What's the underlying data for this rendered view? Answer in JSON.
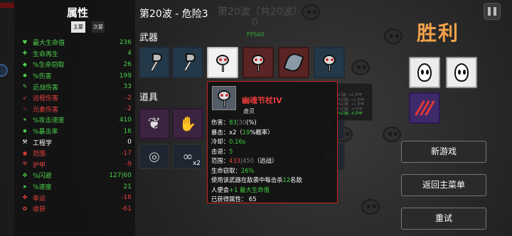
{
  "stats_panel": {
    "title": "属性",
    "tab_main": "主要",
    "tab_secondary": "次要",
    "rows": [
      {
        "label": "最大生命值",
        "value": "236",
        "color": "#4ccf4c",
        "icon": "heart-icon"
      },
      {
        "label": "生命再生",
        "value": "4",
        "color": "#4ccf4c",
        "icon": "plus-heart-icon"
      },
      {
        "label": "%生命窃取",
        "value": "26",
        "color": "#4ccf4c",
        "icon": "fang-icon"
      },
      {
        "label": "%伤害",
        "value": "199",
        "color": "#4ccf4c",
        "icon": "damage-icon"
      },
      {
        "label": "近战伤害",
        "value": "33",
        "color": "#4ccf4c",
        "icon": "sword-icon"
      },
      {
        "label": "远程伤害",
        "value": "-2",
        "color": "#e84040",
        "icon": "bow-icon"
      },
      {
        "label": "元素伤害",
        "value": "-2",
        "color": "#e84040",
        "icon": "flame-icon"
      },
      {
        "label": "%攻击速度",
        "value": "410",
        "color": "#4ccf4c",
        "icon": "speed-icon"
      },
      {
        "label": "%暴击率",
        "value": "16",
        "color": "#4ccf4c",
        "icon": "crit-icon"
      },
      {
        "label": "工程学",
        "value": "0",
        "color": "#ffffff",
        "icon": "wrench-icon"
      },
      {
        "label": "范围",
        "value": "-17",
        "color": "#e84040",
        "icon": "range-icon"
      },
      {
        "label": "护甲",
        "value": "-9",
        "color": "#e84040",
        "icon": "shield-icon"
      },
      {
        "label": "%闪避",
        "value": "127|60",
        "color": "#4ccf4c",
        "icon": "dodge-icon"
      },
      {
        "label": "%速度",
        "value": "21",
        "color": "#4ccf4c",
        "icon": "boot-icon"
      },
      {
        "label": "幸运",
        "value": "-16",
        "color": "#e84040",
        "icon": "clover-icon"
      },
      {
        "label": "收获",
        "value": "-61",
        "color": "#e84040",
        "icon": "harvest-icon"
      }
    ]
  },
  "wave_title": "第20波 - 危险3",
  "ghost_title": "第20波（共20波）",
  "ghost_count": "0",
  "fps": "FPS60",
  "weapons_label": "武器",
  "items_label": "道具",
  "item_badge": "x2",
  "tooltip": {
    "name": "幽魂节杖IV",
    "class": "虚灵",
    "line_damage_label": "伤害：",
    "line_damage_val": "83",
    "line_damage_bracket": "|30",
    "line_damage_pct": "(%)",
    "line_crit_label": "暴击：x2（",
    "line_crit_val": "19",
    "line_crit_suffix": "%概率）",
    "line_cd_label": "冷却：",
    "line_cd_val": "0.16s",
    "line_kb_label": "击退：",
    "line_kb_val": "5",
    "line_range_label": "范围：",
    "line_range_val": "433",
    "line_range_base": "|450",
    "line_range_suffix": "（远战）",
    "line_lifesteal_label": "生命窃取：",
    "line_lifesteal_val": "26%",
    "line_effect_1": "使用该武器在敌袭中每击杀",
    "line_effect_1_num": "12",
    "line_effect_1_end": "名敌",
    "line_effect_2_start": "人便会",
    "line_effect_2_val": "+1 最大生命值",
    "line_obtained": "已获得属性： 65"
  },
  "tooltip2": {
    "name": "虚灵",
    "lines": [
      "(2)+5 %闪避, +6 护甲",
      "(3)+10 %闪避, +2 护甲",
      "(4)+15 %闪避, +1 护甲",
      "(5)+24 %闪避, -4 护甲"
    ],
    "last": "(6)+30 %闪避, -6 护甲"
  },
  "victory": "胜利",
  "buttons": {
    "new_game": "新游戏",
    "main_menu": "返回主菜单",
    "retry": "重试"
  },
  "colors": {
    "victory": "#f2a14a",
    "tooltip_border": "#cc2222",
    "positive": "#4ccf4c",
    "negative": "#e84040"
  }
}
